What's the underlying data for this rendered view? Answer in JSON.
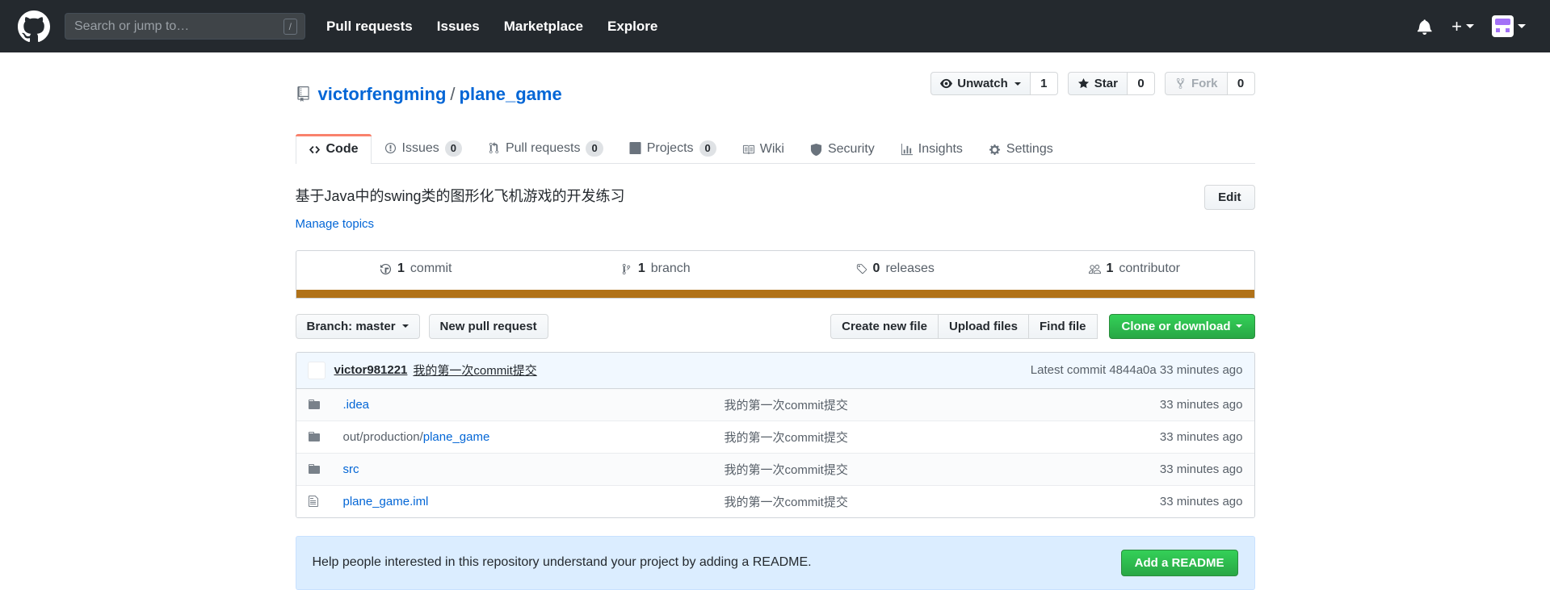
{
  "header": {
    "logo_icon": "github-mark-icon",
    "search": {
      "placeholder": "Search or jump to…",
      "value": "",
      "shortcut_key": "/"
    },
    "nav": [
      {
        "label": "Pull requests"
      },
      {
        "label": "Issues"
      },
      {
        "label": "Marketplace"
      },
      {
        "label": "Explore"
      }
    ],
    "notifications_icon": "bell-icon",
    "create_new_icon": "plus-icon",
    "avatar_icon": "user-avatar"
  },
  "repo": {
    "owner": "victorfengming",
    "separator": "/",
    "name": "plane_game",
    "repo_icon": "repository-icon",
    "actions": {
      "watch": {
        "label": "Unwatch",
        "count": "1",
        "icon": "eye-icon"
      },
      "star": {
        "label": "Star",
        "count": "0",
        "icon": "star-icon"
      },
      "fork": {
        "label": "Fork",
        "count": "0",
        "icon": "fork-icon",
        "disabled": true
      }
    }
  },
  "tabs": [
    {
      "label": "Code",
      "count": null,
      "icon": "code-icon",
      "selected": true
    },
    {
      "label": "Issues",
      "count": "0",
      "icon": "issue-opened-icon",
      "selected": false
    },
    {
      "label": "Pull requests",
      "count": "0",
      "icon": "git-pull-request-icon",
      "selected": false
    },
    {
      "label": "Projects",
      "count": "0",
      "icon": "project-icon",
      "selected": false
    },
    {
      "label": "Wiki",
      "count": null,
      "icon": "book-icon",
      "selected": false
    },
    {
      "label": "Security",
      "count": null,
      "icon": "shield-icon",
      "selected": false
    },
    {
      "label": "Insights",
      "count": null,
      "icon": "graph-icon",
      "selected": false
    },
    {
      "label": "Settings",
      "count": null,
      "icon": "gear-icon",
      "selected": false
    }
  ],
  "about": {
    "description": "基于Java中的swing类的图形化飞机游戏的开发练习",
    "manage_topics_label": "Manage topics",
    "edit_label": "Edit"
  },
  "summary": {
    "commits": {
      "count": "1",
      "label": "commit",
      "icon": "history-icon"
    },
    "branches": {
      "count": "1",
      "label": "branch",
      "icon": "git-branch-icon"
    },
    "releases": {
      "count": "0",
      "label": "releases",
      "icon": "tag-icon"
    },
    "contributors": {
      "count": "1",
      "label": "contributor",
      "icon": "people-icon"
    },
    "language_bar_color": "#b07219"
  },
  "toolbar": {
    "branch_label": "Branch: master",
    "new_pull_request_label": "New pull request",
    "create_new_file_label": "Create new file",
    "upload_files_label": "Upload files",
    "find_file_label": "Find file",
    "clone_label": "Clone or download"
  },
  "latest_commit": {
    "author": "victor981221",
    "message": "我的第一次commit提交",
    "meta_prefix": "Latest commit",
    "sha": "4844a0a",
    "age": "33 minutes ago"
  },
  "files": [
    {
      "name": ".idea",
      "prefix": "",
      "type": "directory",
      "icon": "file-directory-icon",
      "message": "我的第一次commit提交",
      "age": "33 minutes ago"
    },
    {
      "name": "plane_game",
      "prefix": "out/production/",
      "type": "directory",
      "icon": "file-directory-icon",
      "message": "我的第一次commit提交",
      "age": "33 minutes ago"
    },
    {
      "name": "src",
      "prefix": "",
      "type": "directory",
      "icon": "file-directory-icon",
      "message": "我的第一次commit提交",
      "age": "33 minutes ago"
    },
    {
      "name": "plane_game.iml",
      "prefix": "",
      "type": "file",
      "icon": "file-icon",
      "message": "我的第一次commit提交",
      "age": "33 minutes ago"
    }
  ],
  "readme_prompt": {
    "text": "Help people interested in this repository understand your project by adding a README.",
    "button_label": "Add a README"
  }
}
